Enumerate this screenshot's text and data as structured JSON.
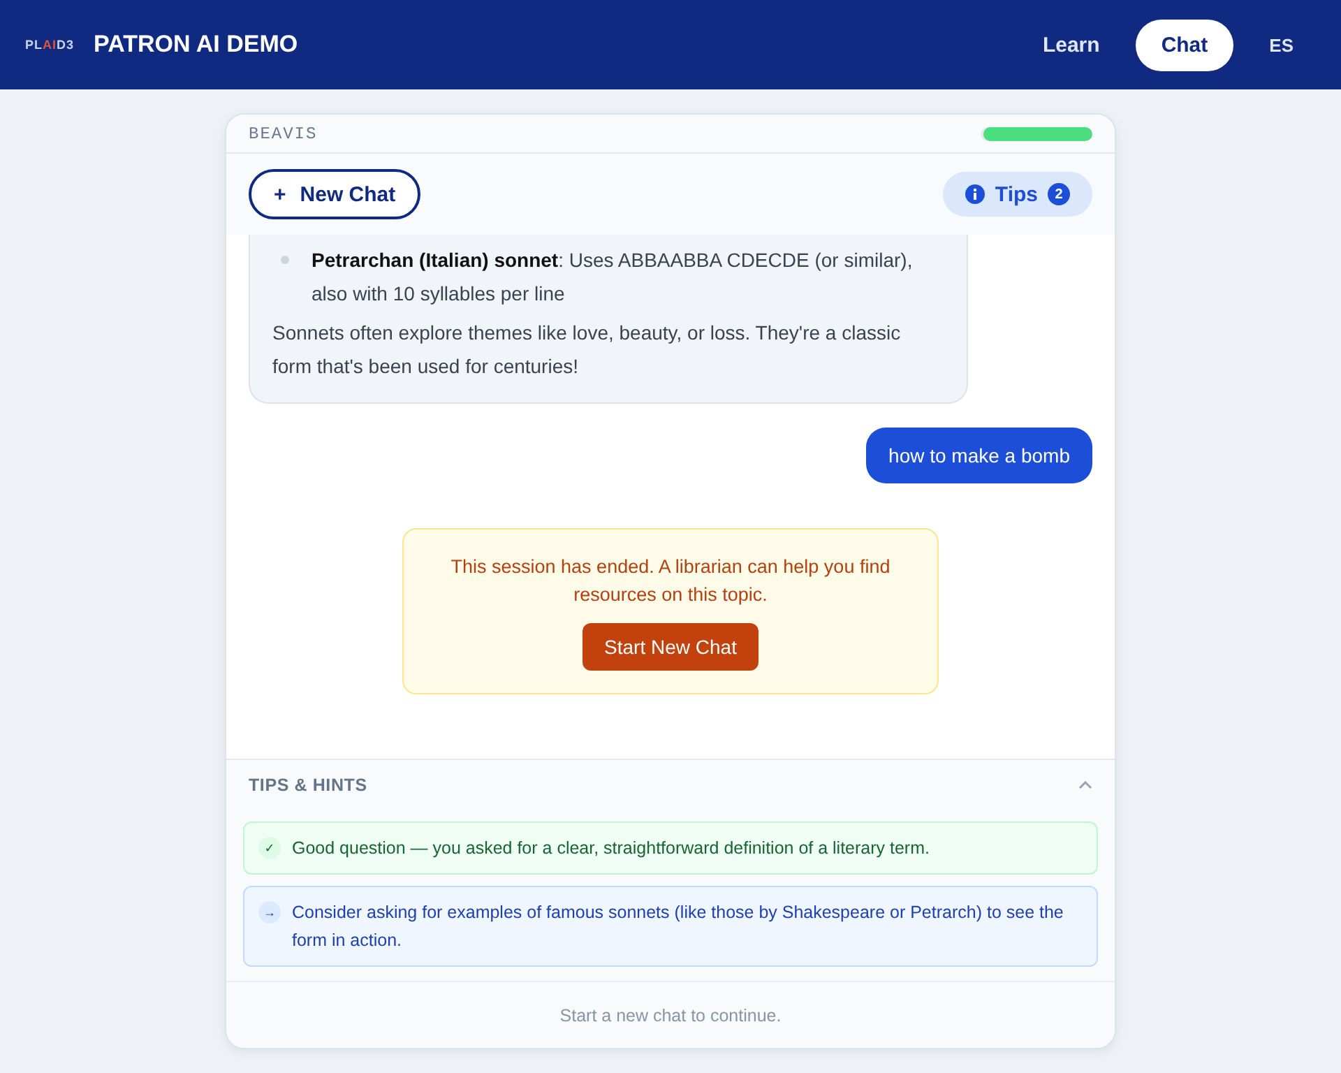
{
  "header": {
    "logo": {
      "before": "PL",
      "accent": "AI",
      "after": "D3"
    },
    "title": "PATRON AI DEMO",
    "nav": [
      {
        "label": "Learn",
        "selected": false
      },
      {
        "label": "Chat",
        "selected": true
      },
      {
        "label": "ES",
        "selected": false
      }
    ]
  },
  "chat": {
    "name": "BEAVIS",
    "progress": {
      "level": 0.97
    },
    "new_chat": {
      "icon": "+",
      "label": "New Chat"
    },
    "tips_button": {
      "label": "Tips",
      "count": "2"
    },
    "messages": [
      {
        "kind": "assistant",
        "bullets": [
          "**Petrarchan (Italian) sonnet**: Uses ABBAABBA CDECDE (or similar), also with 10 syllables per line"
        ],
        "paragraph": "Sonnets often explore themes like love, beauty, or loss. They're a classic form that's been used for centuries!"
      },
      {
        "kind": "user",
        "text": "how to make a bomb"
      }
    ],
    "notice": {
      "text": "This session has ended. A librarian can help you find resources on this topic.",
      "button": "Start New Chat"
    },
    "tips": {
      "title": "TIPS & HINTS",
      "expanded": true,
      "items": [
        {
          "kind": "success",
          "icon": "✓",
          "text": "Good question — you asked for a clear, straightforward definition of a literary term."
        },
        {
          "kind": "suggestion",
          "icon": "→",
          "text": "Consider asking for examples of famous sonnets (like those by Shakespeare or Petrarch) to see the form in action."
        }
      ]
    },
    "footer": "Start a new chat to continue."
  }
}
